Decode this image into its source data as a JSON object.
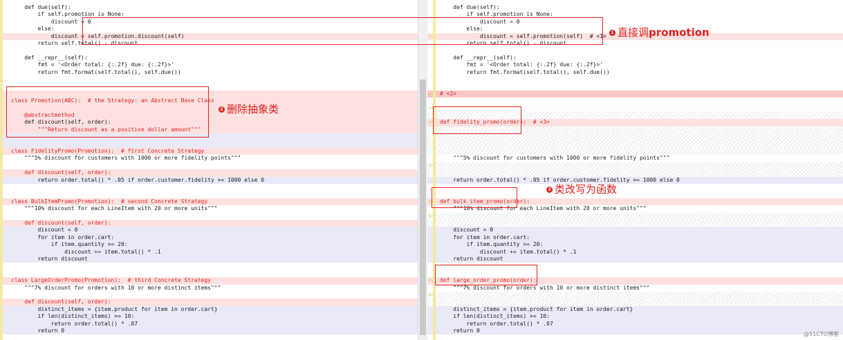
{
  "left_lines": [
    {
      "text": "    def due(self):",
      "cls": ""
    },
    {
      "text": "        if self.promotion is None:",
      "cls": ""
    },
    {
      "text": "            discount = 0",
      "cls": ""
    },
    {
      "text": "        else:",
      "cls": ""
    },
    {
      "text": "            discount = self.promotion.discount(self)",
      "cls": "del"
    },
    {
      "text": "        return self.total() - discount",
      "cls": ""
    },
    {
      "text": "",
      "cls": ""
    },
    {
      "text": "    def __repr__(self):",
      "cls": ""
    },
    {
      "text": "        fmt = '<Order total: {:.2f} due: {:.2f}>'",
      "cls": ""
    },
    {
      "text": "        return fmt.format(self.total(), self.due())",
      "cls": ""
    },
    {
      "text": "",
      "cls": ""
    },
    {
      "text": "",
      "cls": ""
    },
    {
      "text": "",
      "cls": "del"
    },
    {
      "text": "class Promotion(ABC):  # the Strategy: an Abstract Base Class",
      "cls": "del red"
    },
    {
      "text": "",
      "cls": "del"
    },
    {
      "text": "    @abstractmethod",
      "cls": "del red"
    },
    {
      "text": "    def discount(self, order):",
      "cls": "del"
    },
    {
      "text": "        \"\"\"Return discount as a positive dollar amount\"\"\"",
      "cls": "del red"
    },
    {
      "text": "",
      "cls": "blue"
    },
    {
      "text": "",
      "cls": "blue"
    },
    {
      "text": "class FidelityPromo(Promotion):  # first Concrete Strategy",
      "cls": "del red"
    },
    {
      "text": "    \"\"\"5% discount for customers with 1000 or more fidelity points\"\"\"",
      "cls": ""
    },
    {
      "text": "",
      "cls": ""
    },
    {
      "text": "    def discount(self, order):",
      "cls": "del red"
    },
    {
      "text": "        return order.total() * .05 if order.customer.fidelity >= 1000 else 0",
      "cls": "blue"
    },
    {
      "text": "",
      "cls": ""
    },
    {
      "text": "",
      "cls": ""
    },
    {
      "text": "class BulkItemPromo(Promotion):  # second Concrete Strategy",
      "cls": "del red"
    },
    {
      "text": "    \"\"\"10% discount for each LineItem with 20 or more units\"\"\"",
      "cls": ""
    },
    {
      "text": "",
      "cls": ""
    },
    {
      "text": "    def discount(self, order):",
      "cls": "del red"
    },
    {
      "text": "        discount = 0",
      "cls": "blue"
    },
    {
      "text": "        for item in order.cart:",
      "cls": "blue"
    },
    {
      "text": "            if item.quantity >= 20:",
      "cls": "blue"
    },
    {
      "text": "                discount += item.total() * .1",
      "cls": "blue"
    },
    {
      "text": "        return discount",
      "cls": "blue"
    },
    {
      "text": "",
      "cls": ""
    },
    {
      "text": "",
      "cls": ""
    },
    {
      "text": "class LargeOrderPromo(Promotion):  # third Concrete Strategy",
      "cls": "del red"
    },
    {
      "text": "    \"\"\"7% discount for orders with 10 or more distinct items\"\"\"",
      "cls": ""
    },
    {
      "text": "",
      "cls": ""
    },
    {
      "text": "    def discount(self, order):",
      "cls": "del red"
    },
    {
      "text": "        distinct_items = {item.product for item in order.cart}",
      "cls": "blue"
    },
    {
      "text": "        if len(distinct_items) >= 10:",
      "cls": "blue"
    },
    {
      "text": "            return order.total() * .07",
      "cls": "blue"
    },
    {
      "text": "        return 0",
      "cls": "blue"
    }
  ],
  "right_lines": [
    {
      "text": "    def due(self):",
      "cls": "",
      "mark": ""
    },
    {
      "text": "        if self.promotion is None:",
      "cls": "",
      "mark": ""
    },
    {
      "text": "            discount = 0",
      "cls": "",
      "mark": ""
    },
    {
      "text": "        else:",
      "cls": "",
      "mark": ""
    },
    {
      "text": "            discount = self.promotion(self)  # <1>",
      "cls": "del",
      "mark": "⇦"
    },
    {
      "text": "        return self.total() - discount",
      "cls": "",
      "mark": ""
    },
    {
      "text": "",
      "cls": "",
      "mark": ""
    },
    {
      "text": "    def __repr__(self):",
      "cls": "",
      "mark": ""
    },
    {
      "text": "        fmt = '<Order total: {:.2f} due: {:.2f}>'",
      "cls": "",
      "mark": ""
    },
    {
      "text": "        return fmt.format(self.total(), self.due())",
      "cls": "",
      "mark": ""
    },
    {
      "text": "",
      "cls": "",
      "mark": ""
    },
    {
      "text": "",
      "cls": "",
      "mark": ""
    },
    {
      "text": "# <2>",
      "cls": "del-strong red",
      "mark": "⇦"
    },
    {
      "text": "",
      "cls": "",
      "mark": ""
    },
    {
      "text": "",
      "cls": "",
      "mark": "⇦"
    },
    {
      "text": "",
      "cls": "hatch",
      "mark": ""
    },
    {
      "text": "def fidelity_promo(order):  # <3>",
      "cls": "del red",
      "mark": "⇦"
    },
    {
      "text": "",
      "cls": "hatch",
      "mark": ""
    },
    {
      "text": "",
      "cls": "hatch",
      "mark": ""
    },
    {
      "text": "",
      "cls": "hatch",
      "mark": ""
    },
    {
      "text": "",
      "cls": "hatch",
      "mark": ""
    },
    {
      "text": "    \"\"\"5% discount for customers with 1000 or more fidelity points\"\"\"",
      "cls": "",
      "mark": ""
    },
    {
      "text": "",
      "cls": "hatch",
      "mark": "⇦"
    },
    {
      "text": "",
      "cls": "hatch",
      "mark": ""
    },
    {
      "text": "    return order.total() * .05 if order.customer.fidelity >= 1000 else 0",
      "cls": "blue",
      "mark": ""
    },
    {
      "text": "",
      "cls": "",
      "mark": ""
    },
    {
      "text": "",
      "cls": "",
      "mark": ""
    },
    {
      "text": "def bulk_item_promo(order):",
      "cls": "del red",
      "mark": "⇦"
    },
    {
      "text": "    \"\"\"10% discount for each LineItem with 20 or more units\"\"\"",
      "cls": "",
      "mark": ""
    },
    {
      "text": "",
      "cls": "hatch",
      "mark": "⇦"
    },
    {
      "text": "",
      "cls": "hatch",
      "mark": ""
    },
    {
      "text": "    discount = 0",
      "cls": "blue",
      "mark": ""
    },
    {
      "text": "    for item in order.cart:",
      "cls": "blue",
      "mark": ""
    },
    {
      "text": "        if item.quantity >= 20:",
      "cls": "blue",
      "mark": ""
    },
    {
      "text": "            discount += item.total() * .1",
      "cls": "blue",
      "mark": ""
    },
    {
      "text": "    return discount",
      "cls": "blue",
      "mark": ""
    },
    {
      "text": "",
      "cls": "",
      "mark": ""
    },
    {
      "text": "",
      "cls": "",
      "mark": ""
    },
    {
      "text": "def large_order_promo(order):",
      "cls": "del red",
      "mark": "⇦"
    },
    {
      "text": "    \"\"\"7% discount for orders with 10 or more distinct items\"\"\"",
      "cls": "",
      "mark": ""
    },
    {
      "text": "",
      "cls": "hatch",
      "mark": "⇦"
    },
    {
      "text": "",
      "cls": "hatch",
      "mark": ""
    },
    {
      "text": "    distinct_items = {item.product for item in order.cart}",
      "cls": "blue",
      "mark": ""
    },
    {
      "text": "    if len(distinct_items) >= 10:",
      "cls": "blue",
      "mark": ""
    },
    {
      "text": "        return order.total() * .07",
      "cls": "blue",
      "mark": ""
    },
    {
      "text": "    return 0",
      "cls": "blue",
      "mark": ""
    }
  ],
  "annotations": {
    "a1": {
      "num": "1",
      "text_plain": "直接调",
      "text_bold": "promotion"
    },
    "a2": {
      "num": "2",
      "text": "删除抽象类"
    },
    "a3": {
      "num": "3",
      "text": "类改写为函数"
    }
  },
  "watermark": "@51CTO博客",
  "colors": {
    "annotation": "#e0211d",
    "deleted_bg": "#fde1e1",
    "changed_bg": "#e9e9f8",
    "gutter": "#f3e9a2"
  }
}
